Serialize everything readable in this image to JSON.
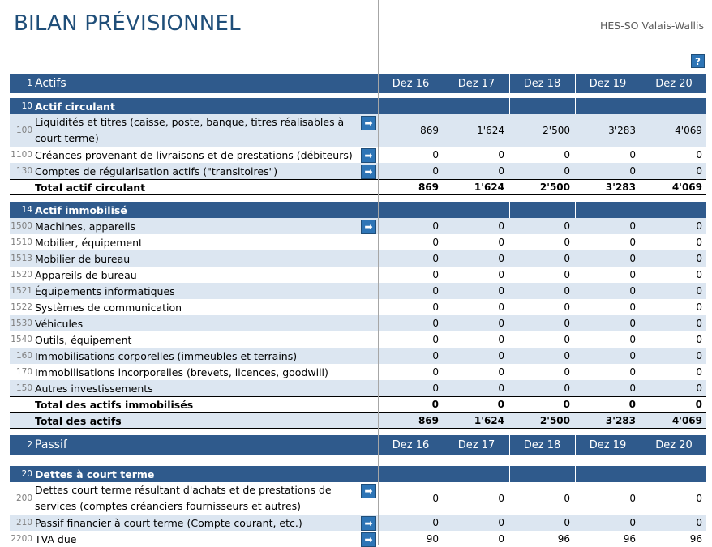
{
  "title": "BILAN PRÉVISIONNEL",
  "org": "HES-SO Valais-Wallis",
  "help_label": "?",
  "columns": [
    "Dez 16",
    "Dez 17",
    "Dez 18",
    "Dez 19",
    "Dez 20"
  ],
  "arrow_glyph": "➡",
  "rows": [
    {
      "kind": "hdr",
      "code": "1",
      "label": "Actifs"
    },
    {
      "kind": "sect",
      "code": "10",
      "label": "Actif circulant"
    },
    {
      "kind": "item",
      "shade": true,
      "tall": true,
      "arrow": true,
      "code": "100",
      "label": "Liquidités et titres (caisse, poste, banque, titres réalisables à court terme)",
      "values": [
        "869",
        "1'624",
        "2'500",
        "3'283",
        "4'069"
      ]
    },
    {
      "kind": "item",
      "shade": false,
      "arrow": true,
      "code": "1100",
      "label": "Créances provenant de livraisons et de prestations (débiteurs)",
      "values": [
        "0",
        "0",
        "0",
        "0",
        "0"
      ]
    },
    {
      "kind": "item",
      "shade": true,
      "arrow": true,
      "code": "130",
      "label": "Comptes de régularisation actifs (\"transitoires\")",
      "values": [
        "0",
        "0",
        "0",
        "0",
        "0"
      ]
    },
    {
      "kind": "total",
      "shade": false,
      "code": "",
      "label": "Total actif circulant",
      "values": [
        "869",
        "1'624",
        "2'500",
        "3'283",
        "4'069"
      ]
    },
    {
      "kind": "gap"
    },
    {
      "kind": "sect",
      "code": "14",
      "label": "Actif immobilisé"
    },
    {
      "kind": "item",
      "shade": true,
      "arrow": true,
      "code": "1500",
      "label": "Machines, appareils",
      "values": [
        "0",
        "0",
        "0",
        "0",
        "0"
      ]
    },
    {
      "kind": "item",
      "shade": false,
      "code": "1510",
      "label": "Mobilier, équipement",
      "values": [
        "0",
        "0",
        "0",
        "0",
        "0"
      ]
    },
    {
      "kind": "item",
      "shade": true,
      "code": "1513",
      "label": "Mobilier de bureau",
      "values": [
        "0",
        "0",
        "0",
        "0",
        "0"
      ]
    },
    {
      "kind": "item",
      "shade": false,
      "code": "1520",
      "label": "Appareils de bureau",
      "values": [
        "0",
        "0",
        "0",
        "0",
        "0"
      ]
    },
    {
      "kind": "item",
      "shade": true,
      "code": "1521",
      "label": "Équipements informatiques",
      "values": [
        "0",
        "0",
        "0",
        "0",
        "0"
      ]
    },
    {
      "kind": "item",
      "shade": false,
      "code": "1522",
      "label": "Systèmes de communication",
      "values": [
        "0",
        "0",
        "0",
        "0",
        "0"
      ]
    },
    {
      "kind": "item",
      "shade": true,
      "code": "1530",
      "label": "Véhicules",
      "values": [
        "0",
        "0",
        "0",
        "0",
        "0"
      ]
    },
    {
      "kind": "item",
      "shade": false,
      "code": "1540",
      "label": "Outils, équipement",
      "values": [
        "0",
        "0",
        "0",
        "0",
        "0"
      ]
    },
    {
      "kind": "item",
      "shade": true,
      "code": "160",
      "label": "Immobilisations corporelles (immeubles et terrains)",
      "values": [
        "0",
        "0",
        "0",
        "0",
        "0"
      ]
    },
    {
      "kind": "item",
      "shade": false,
      "code": "170",
      "label": "Immobilisations incorporelles (brevets, licences, goodwill)",
      "values": [
        "0",
        "0",
        "0",
        "0",
        "0"
      ]
    },
    {
      "kind": "item",
      "shade": true,
      "code": "150",
      "label": "Autres investissements",
      "values": [
        "0",
        "0",
        "0",
        "0",
        "0"
      ]
    },
    {
      "kind": "total",
      "shade": false,
      "code": "",
      "label": "Total des actifs immobilisés",
      "values": [
        "0",
        "0",
        "0",
        "0",
        "0"
      ]
    },
    {
      "kind": "total",
      "shade": true,
      "code": "",
      "label": "Total des actifs",
      "values": [
        "869",
        "1'624",
        "2'500",
        "3'283",
        "4'069"
      ]
    },
    {
      "kind": "gap"
    },
    {
      "kind": "hdr",
      "code": "2",
      "label": "Passif"
    },
    {
      "kind": "gap"
    },
    {
      "kind": "sect",
      "code": "20",
      "label": "Dettes à court terme"
    },
    {
      "kind": "item",
      "shade": false,
      "tall": true,
      "arrow": true,
      "code": "200",
      "label": "Dettes court terme résultant d'achats et de prestations de services (comptes créanciers fournisseurs et autres)",
      "values": [
        "0",
        "0",
        "0",
        "0",
        "0"
      ]
    },
    {
      "kind": "item",
      "shade": true,
      "arrow": true,
      "code": "210",
      "label": "Passif financier à court terme (Compte courant, etc.)",
      "values": [
        "0",
        "0",
        "0",
        "0",
        "0"
      ]
    },
    {
      "kind": "item",
      "shade": false,
      "arrow": true,
      "code": "2200",
      "label": "TVA due",
      "values": [
        "90",
        "0",
        "96",
        "96",
        "96"
      ]
    }
  ]
}
